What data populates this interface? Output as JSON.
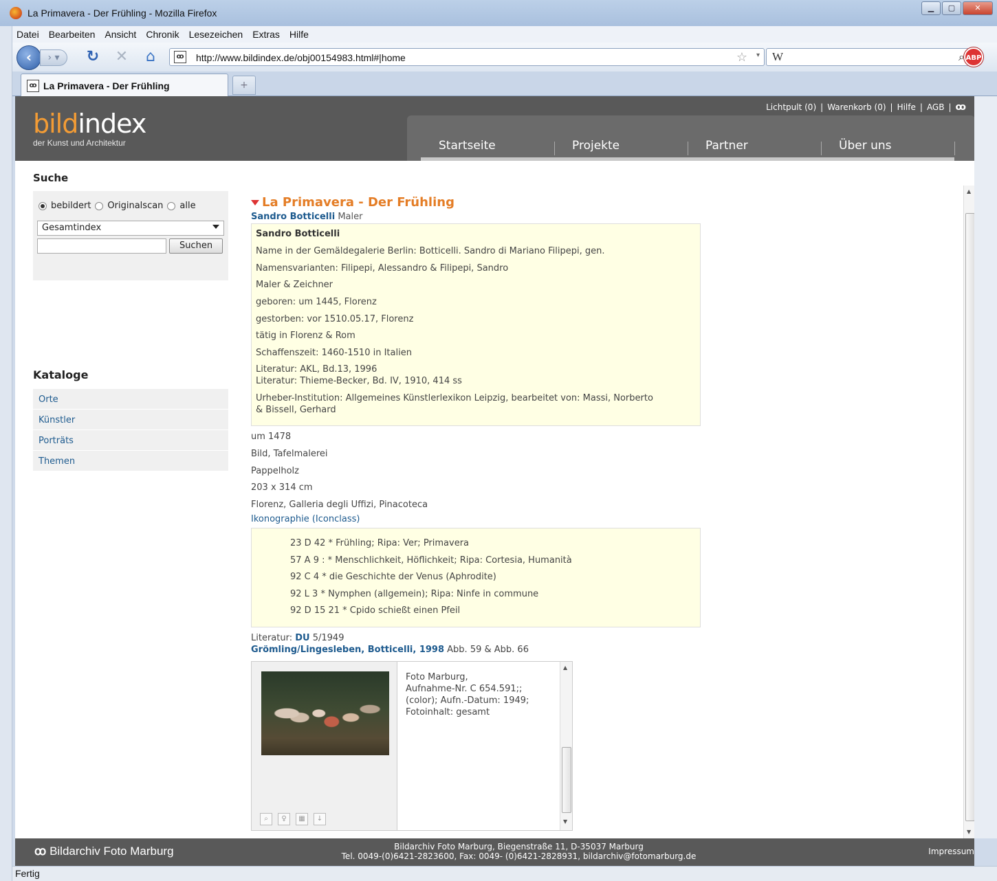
{
  "window": {
    "title": "La Primavera - Der Frühling - Mozilla Firefox"
  },
  "menu": [
    "Datei",
    "Bearbeiten",
    "Ansicht",
    "Chronik",
    "Lesezeichen",
    "Extras",
    "Hilfe"
  ],
  "navbar": {
    "url": "http://www.bildindex.de/obj00154983.html#|home",
    "search_engine": "W",
    "addon": "ABP"
  },
  "tab": {
    "title": "La Primavera - Der Frühling"
  },
  "site": {
    "logo_part1": "bild",
    "logo_part2": "index",
    "logo_sub": "der Kunst und Architektur",
    "toplinks": [
      "Lichtpult (0)",
      "Warenkorb (0)",
      "Hilfe",
      "AGB"
    ],
    "nav": [
      "Startseite",
      "Projekte",
      "Partner",
      "Über uns"
    ]
  },
  "sidebar": {
    "search_heading": "Suche",
    "radios": [
      {
        "label": "bebildert",
        "checked": true
      },
      {
        "label": "Originalscan",
        "checked": false
      },
      {
        "label": "alle",
        "checked": false
      }
    ],
    "select_value": "Gesamtindex",
    "search_button": "Suchen",
    "catalog_heading": "Kataloge",
    "catalogs": [
      "Orte",
      "Künstler",
      "Porträts",
      "Themen"
    ]
  },
  "record": {
    "title": "La Primavera - Der Frühling",
    "artist_link": "Sandro Botticelli",
    "artist_role": "Maler",
    "artist_box": {
      "name": "Sandro Botticelli",
      "lines": [
        "Name in der Gemäldegalerie Berlin: Botticelli. Sandro di Mariano Filipepi, gen.",
        "Namensvarianten: Filipepi, Alessandro & Filipepi, Sandro",
        "Maler & Zeichner",
        "geboren: um 1445, Florenz",
        "gestorben: vor 1510.05.17, Florenz",
        "tätig in Florenz & Rom",
        "Schaffenszeit: 1460-1510 in Italien",
        "Literatur: AKL, Bd.13, 1996",
        "Literatur: Thieme-Becker, Bd. IV, 1910, 414 ss",
        "Urheber-Institution: Allgemeines Künstlerlexikon Leipzig, bearbeitet von: Massi, Norberto",
        "& Bissell, Gerhard"
      ]
    },
    "details": [
      "um 1478",
      "Bild, Tafelmalerei",
      "Pappelholz",
      "203 x 314 cm",
      "Florenz, Galleria degli Uffizi, Pinacoteca"
    ],
    "iconography_link": "Ikonographie (Iconclass)",
    "iconography": [
      "23 D 42 * Frühling; Ripa: Ver; Primavera",
      "57 A 9 : * Menschlichkeit, Höflichkeit; Ripa: Cortesia, Humanità",
      "92 C 4 * die Geschichte der Venus (Aphrodite)",
      "92 L 3 * Nymphen (allgemein); Ripa: Ninfe in commune",
      "92 D 15 21 * Cpido schießt einen Pfeil"
    ],
    "literature_label": "Literatur:",
    "literature_du": "DU",
    "literature_du_rest": "5/1949",
    "literature2_link": "Grömling/Lingesleben, Botticelli, 1998",
    "literature2_rest": "Abb. 59 & Abb. 66",
    "photo_lines": [
      "Foto Marburg,",
      "Aufnahme-Nr. C 654.591;;",
      "(color); Aufn.-Datum: 1949;",
      "Fotoinhalt: gesamt"
    ]
  },
  "footer": {
    "logo": "Bildarchiv Foto Marburg",
    "address1": "Bildarchiv Foto Marburg, Biegenstraße 11, D-35037 Marburg",
    "address2": "Tel. 0049-(0)6421-2823600, Fax: 0049- (0)6421-2828931, bildarchiv@fotomarburg.de",
    "impressum": "Impressum"
  },
  "status": "Fertig"
}
